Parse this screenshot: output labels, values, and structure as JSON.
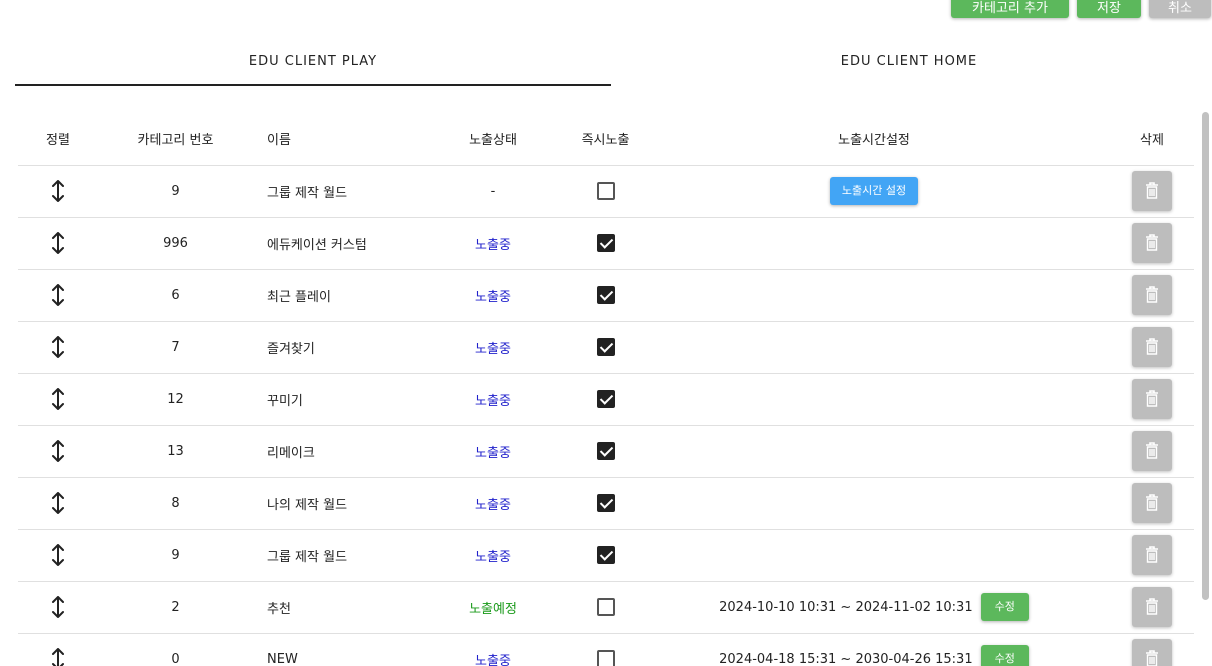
{
  "toolbar": {
    "add_category_label": "카테고리 추가",
    "save_label": "저장",
    "cancel_label": "취소"
  },
  "tabs": [
    {
      "label": "EDU CLIENT PLAY",
      "active": true
    },
    {
      "label": "EDU CLIENT HOME",
      "active": false
    }
  ],
  "table": {
    "headers": {
      "sort": "정렬",
      "category_number": "카테고리 번호",
      "name": "이름",
      "status": "노출상태",
      "instant": "즉시노출",
      "time_setting": "노출시간설정",
      "delete": "삭제"
    },
    "rows": [
      {
        "category_number": "9",
        "name": "그룹 제작 월드",
        "status": "-",
        "status_type": "none",
        "instant": false,
        "time_button": "노출시간 설정",
        "time_range": "",
        "edit_label": ""
      },
      {
        "category_number": "996",
        "name": "에듀케이션 커스텀",
        "status": "노출중",
        "status_type": "active",
        "instant": true,
        "time_button": "",
        "time_range": "",
        "edit_label": ""
      },
      {
        "category_number": "6",
        "name": "최근 플레이",
        "status": "노출중",
        "status_type": "active",
        "instant": true,
        "time_button": "",
        "time_range": "",
        "edit_label": ""
      },
      {
        "category_number": "7",
        "name": "즐겨찾기",
        "status": "노출중",
        "status_type": "active",
        "instant": true,
        "time_button": "",
        "time_range": "",
        "edit_label": ""
      },
      {
        "category_number": "12",
        "name": "꾸미기",
        "status": "노출중",
        "status_type": "active",
        "instant": true,
        "time_button": "",
        "time_range": "",
        "edit_label": ""
      },
      {
        "category_number": "13",
        "name": "리메이크",
        "status": "노출중",
        "status_type": "active",
        "instant": true,
        "time_button": "",
        "time_range": "",
        "edit_label": ""
      },
      {
        "category_number": "8",
        "name": "나의 제작 월드",
        "status": "노출중",
        "status_type": "active",
        "instant": true,
        "time_button": "",
        "time_range": "",
        "edit_label": ""
      },
      {
        "category_number": "9",
        "name": "그룹 제작 월드",
        "status": "노출중",
        "status_type": "active",
        "instant": true,
        "time_button": "",
        "time_range": "",
        "edit_label": ""
      },
      {
        "category_number": "2",
        "name": "추천",
        "status": "노출예정",
        "status_type": "scheduled",
        "instant": false,
        "time_button": "",
        "time_range": "2024-10-10 10:31 ~ 2024-11-02 10:31",
        "edit_label": "수정"
      },
      {
        "category_number": "0",
        "name": "NEW",
        "status": "노출중",
        "status_type": "active",
        "instant": false,
        "time_button": "",
        "time_range": "2024-04-18 15:31 ~ 2030-04-26 15:31",
        "edit_label": "수정"
      }
    ]
  },
  "icons": {
    "sort": "sort-vertical-arrows-icon",
    "delete": "trash-icon"
  },
  "colors": {
    "green": "#5cb85c",
    "blue_button": "#42a5f5",
    "grey_button": "#bdbdbd",
    "status_active": "#2222cc",
    "status_scheduled": "#1a9a1a"
  }
}
